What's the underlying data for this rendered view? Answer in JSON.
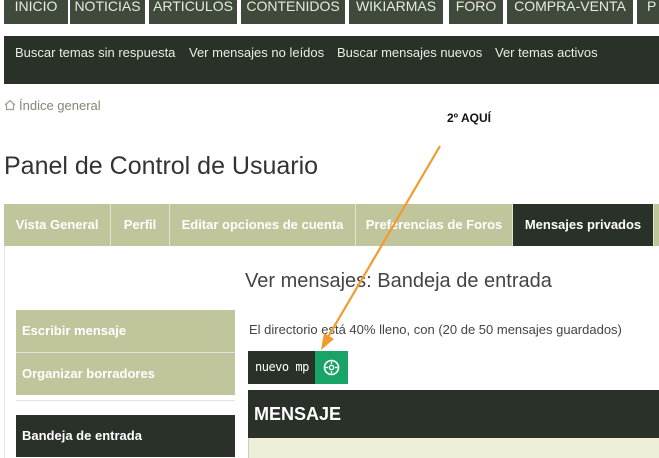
{
  "top_nav": {
    "items": [
      "INICIO",
      "NOTICIAS",
      "ARTICULOS",
      "CONTENIDOS",
      "WIKIARMAS",
      "FORO",
      "COMPRA-VENTA",
      "P"
    ]
  },
  "quick_links": [
    "Buscar temas sin respuesta",
    "Ver mensajes no leídos",
    "Buscar mensajes nuevos",
    "Ver temas activos"
  ],
  "breadcrumb": {
    "label": "Índice general"
  },
  "page_title": "Panel de Control de Usuario",
  "tabs": [
    "Vista General",
    "Perfil",
    "Editar opciones de cuenta",
    "Preferencias de Foros",
    "Mensajes privados"
  ],
  "section_title": "Ver mensajes: Bandeja de entrada",
  "sidebar": {
    "items": [
      "Escribir mensaje",
      "Organizar borradores",
      "Bandeja de entrada"
    ]
  },
  "status_line": "El directorio está 40% lleno, con (20 de 50 mensajes guardados)",
  "new_pm_button": {
    "label": "nuevo mp",
    "icon": "gear-icon"
  },
  "message_header": "MENSAJE",
  "annotation": {
    "text": "2º AQUÍ",
    "color": "#f39a2c"
  },
  "colors": {
    "dark": "#2a3129",
    "olive": "#c1c59b",
    "green_accent": "#1aa367",
    "nav_dark": "#3f4a3c"
  }
}
